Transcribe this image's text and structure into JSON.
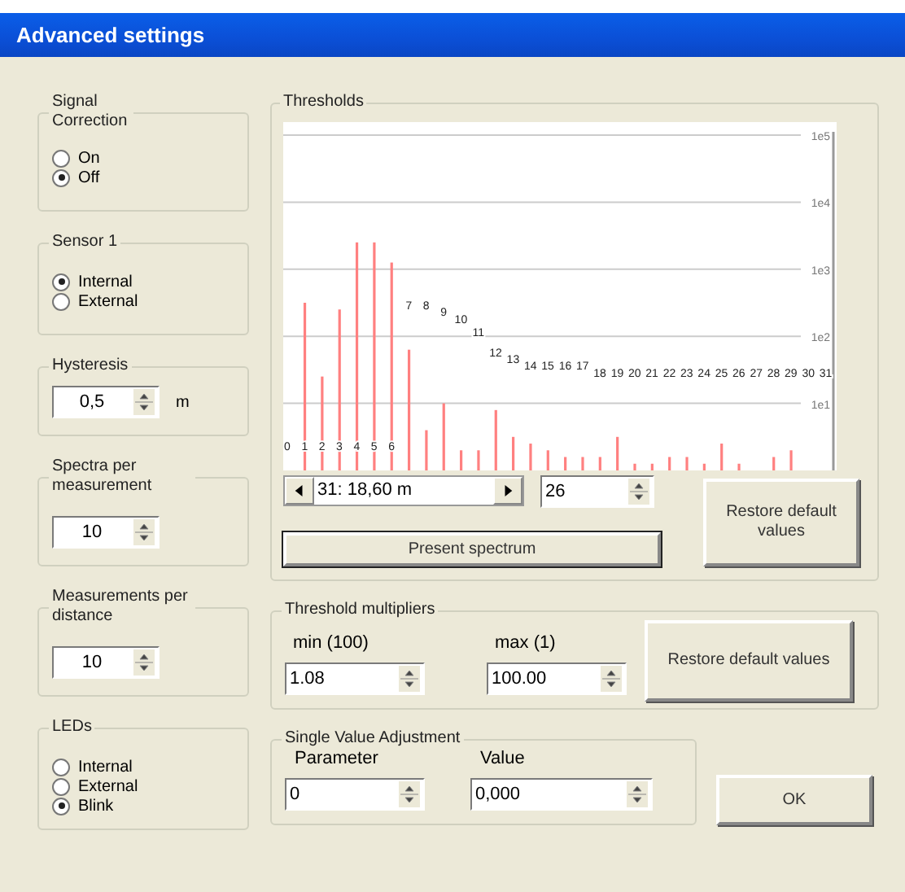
{
  "window": {
    "title": "Advanced settings"
  },
  "left_panels": [
    {
      "kind": "radio",
      "title": "Signal Correction",
      "options": [
        {
          "label": "On",
          "selected": false
        },
        {
          "label": "Off",
          "selected": true
        }
      ]
    },
    {
      "kind": "radio",
      "title": "Sensor 1",
      "options": [
        {
          "label": "Internal",
          "selected": true
        },
        {
          "label": "External",
          "selected": false
        }
      ]
    },
    {
      "kind": "spin",
      "title": "Hysteresis",
      "value": "0,5",
      "unit": "m"
    },
    {
      "kind": "spin",
      "title": "Spectra per measurement",
      "value": "10"
    },
    {
      "kind": "spin",
      "title": "Measurements per distance",
      "value": "10"
    },
    {
      "kind": "radio",
      "title": "LEDs",
      "options": [
        {
          "label": "Internal",
          "selected": false
        },
        {
          "label": "External",
          "selected": false
        },
        {
          "label": "Blink",
          "selected": true
        }
      ]
    }
  ],
  "thresholds": {
    "title": "Thresholds",
    "axis_labels": [
      "1e5",
      "1e4",
      "1e3",
      "1e2",
      "1e1"
    ],
    "point_labels": [
      "0",
      "1",
      "2",
      "3",
      "4",
      "5",
      "6",
      "7",
      "8",
      "9",
      "10",
      "11",
      "12",
      "13",
      "14",
      "15",
      "16",
      "17",
      "18",
      "19",
      "20",
      "21",
      "22",
      "23",
      "24",
      "25",
      "26",
      "27",
      "28",
      "29",
      "30",
      "31"
    ],
    "position": "31: 18,60 m",
    "count": "26",
    "present_button": "Present spectrum",
    "restore_button": "Restore default values"
  },
  "threshold_multipliers": {
    "title": "Threshold multipliers",
    "min_label": "min (100)",
    "min_value": "1.08",
    "max_label": "max (1)",
    "max_value": "100.00",
    "restore_button": "Restore default values"
  },
  "single_value_adjustment": {
    "title": "Single Value Adjustment",
    "parameter_label": "Parameter",
    "parameter_value": "0",
    "value_label": "Value",
    "value_value": "0,000"
  },
  "ok_button": "OK"
}
